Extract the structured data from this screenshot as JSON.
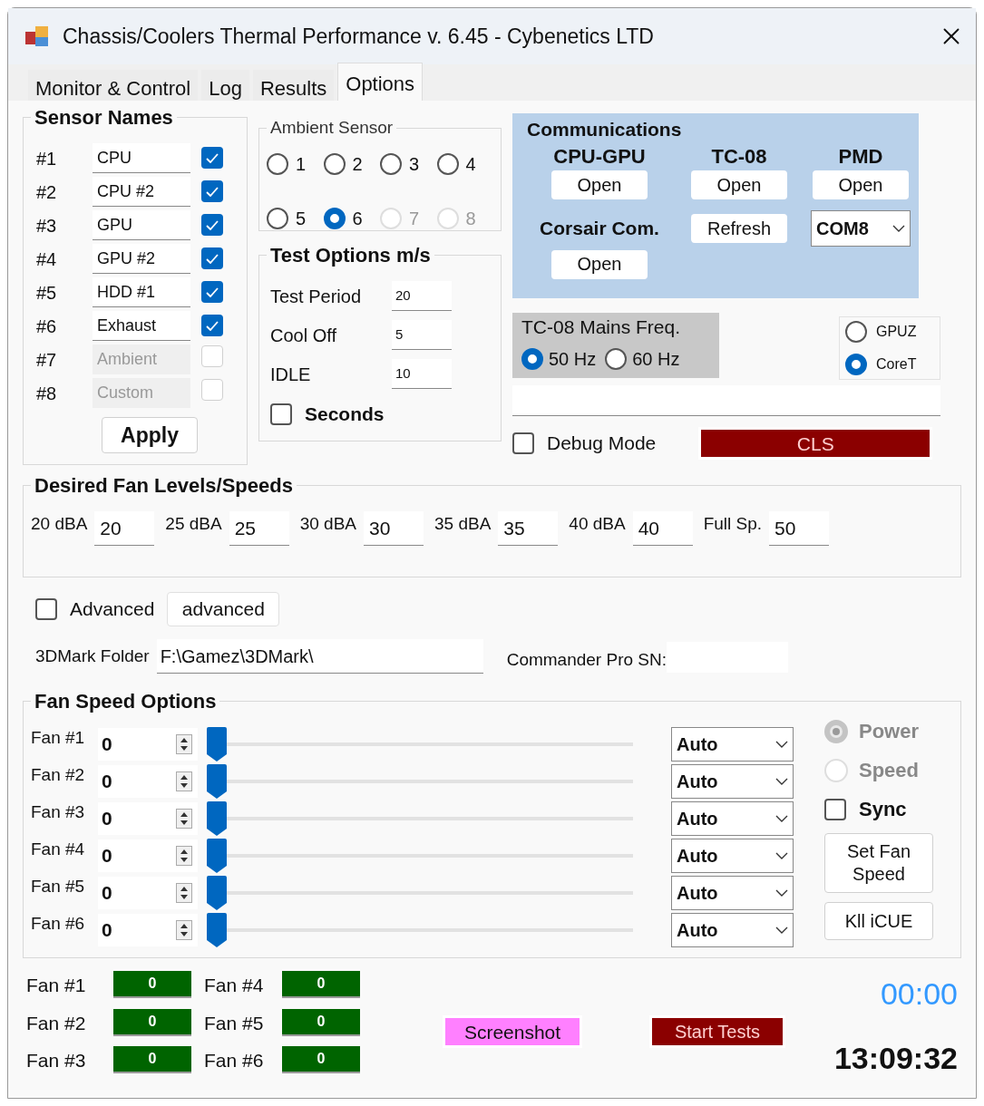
{
  "window": {
    "title": "Chassis/Coolers Thermal Performance v. 6.45 - Cybenetics LTD"
  },
  "tabs": [
    {
      "label": "Monitor & Control",
      "selected": false
    },
    {
      "label": "Log",
      "selected": false
    },
    {
      "label": "Results",
      "selected": false
    },
    {
      "label": "Options",
      "selected": true
    }
  ],
  "sensor_names": {
    "title": "Sensor Names",
    "rows": [
      {
        "label": "#1",
        "value": "CPU",
        "checked": true,
        "disabled": false
      },
      {
        "label": "#2",
        "value": "CPU #2",
        "checked": true,
        "disabled": false
      },
      {
        "label": "#3",
        "value": "GPU",
        "checked": true,
        "disabled": false
      },
      {
        "label": "#4",
        "value": "GPU #2",
        "checked": true,
        "disabled": false
      },
      {
        "label": "#5",
        "value": "HDD #1",
        "checked": true,
        "disabled": false
      },
      {
        "label": "#6",
        "value": "Exhaust",
        "checked": true,
        "disabled": false
      },
      {
        "label": "#7",
        "value": "Ambient",
        "checked": false,
        "disabled": true
      },
      {
        "label": "#8",
        "value": "Custom",
        "checked": false,
        "disabled": true
      }
    ],
    "apply": "Apply"
  },
  "ambient_sensor": {
    "title": "Ambient Sensor",
    "options": [
      {
        "label": "1",
        "selected": false,
        "disabled": false
      },
      {
        "label": "2",
        "selected": false,
        "disabled": false
      },
      {
        "label": "3",
        "selected": false,
        "disabled": false
      },
      {
        "label": "4",
        "selected": false,
        "disabled": false
      },
      {
        "label": "5",
        "selected": false,
        "disabled": false
      },
      {
        "label": "6",
        "selected": true,
        "disabled": false
      },
      {
        "label": "7",
        "selected": false,
        "disabled": true
      },
      {
        "label": "8",
        "selected": false,
        "disabled": true
      }
    ]
  },
  "test_options": {
    "title": "Test Options m/s",
    "fields": [
      {
        "label": "Test Period",
        "value": "20"
      },
      {
        "label": "Cool Off",
        "value": "5"
      },
      {
        "label": "IDLE",
        "value": "10"
      }
    ],
    "seconds": {
      "label": "Seconds",
      "checked": false
    }
  },
  "communications": {
    "title": "Communications",
    "devices": [
      {
        "label": "CPU-GPU",
        "button": "Open"
      },
      {
        "label": "TC-08",
        "button": "Open"
      },
      {
        "label": "PMD",
        "button": "Open"
      }
    ],
    "corsair": {
      "label": "Corsair Com.",
      "refresh": "Refresh",
      "port": "COM8",
      "button": "Open"
    }
  },
  "mains_freq": {
    "title": "TC-08 Mains Freq.",
    "options": [
      {
        "label": "50 Hz",
        "selected": true
      },
      {
        "label": "60 Hz",
        "selected": false
      }
    ]
  },
  "source": {
    "options": [
      {
        "label": "GPUZ",
        "selected": false
      },
      {
        "label": "CoreT",
        "selected": true
      }
    ]
  },
  "debug": {
    "label": "Debug Mode",
    "checked": false
  },
  "cls": "CLS",
  "fan_levels": {
    "title": "Desired Fan Levels/Speeds",
    "items": [
      {
        "label": "20 dBA",
        "value": "20"
      },
      {
        "label": "25 dBA",
        "value": "25"
      },
      {
        "label": "30 dBA",
        "value": "30"
      },
      {
        "label": "35 dBA",
        "value": "35"
      },
      {
        "label": "40 dBA",
        "value": "40"
      },
      {
        "label": "Full Sp.",
        "value": "50"
      }
    ]
  },
  "advanced": {
    "label": "Advanced",
    "checked": false,
    "button": "advanced"
  },
  "folder": {
    "label": "3DMark Folder",
    "value": "F:\\Gamez\\3DMark\\"
  },
  "commander": {
    "label": "Commander Pro SN:"
  },
  "fan_speed": {
    "title": "Fan Speed Options",
    "fans": [
      {
        "label": "Fan #1",
        "value": "0",
        "level": 0,
        "mode": "Auto"
      },
      {
        "label": "Fan #2",
        "value": "0",
        "level": 0,
        "mode": "Auto"
      },
      {
        "label": "Fan #3",
        "value": "0",
        "level": 0,
        "mode": "Auto"
      },
      {
        "label": "Fan #4",
        "value": "0",
        "level": 0,
        "mode": "Auto"
      },
      {
        "label": "Fan #5",
        "value": "0",
        "level": 0,
        "mode": "Auto"
      },
      {
        "label": "Fan #6",
        "value": "0",
        "level": 0,
        "mode": "Auto"
      }
    ],
    "modes": [
      {
        "label": "Power",
        "selected": true,
        "disabled": true
      },
      {
        "label": "Speed",
        "selected": false,
        "disabled": true
      }
    ],
    "sync": {
      "label": "Sync",
      "checked": false
    },
    "set_button": "Set Fan Speed",
    "kill_button": "Kll iCUE"
  },
  "readouts": [
    {
      "label": "Fan #1",
      "value": "0"
    },
    {
      "label": "Fan #2",
      "value": "0"
    },
    {
      "label": "Fan #3",
      "value": "0"
    },
    {
      "label": "Fan #4",
      "value": "0"
    },
    {
      "label": "Fan #5",
      "value": "0"
    },
    {
      "label": "Fan #6",
      "value": "0"
    }
  ],
  "screenshot": "Screenshot",
  "start": "Start Tests",
  "timer": "00:00",
  "clock": "13:09:32"
}
